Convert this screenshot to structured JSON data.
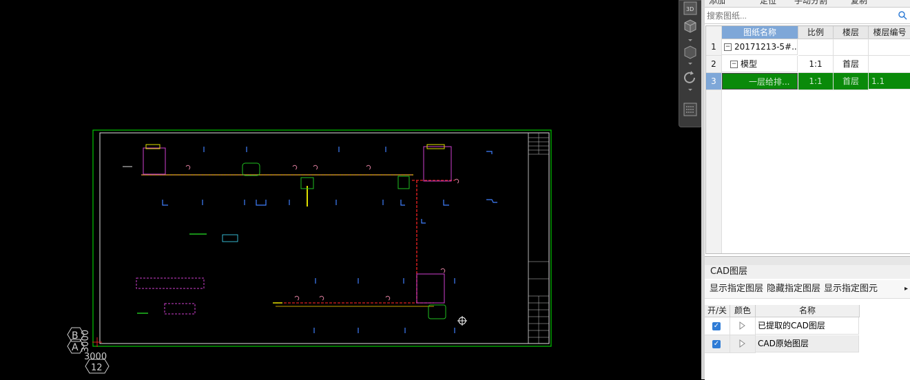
{
  "canvas": {
    "axis_labels": [
      "B",
      "A",
      "3000",
      "3000",
      "12"
    ]
  },
  "view_tools": {
    "button_3d_label": "3D"
  },
  "toolbar": {
    "items": [
      "添加",
      "定位",
      "手动分割",
      "复制"
    ]
  },
  "search": {
    "placeholder": "搜索图纸..."
  },
  "drawing_table": {
    "columns": [
      "图纸名称",
      "比例",
      "楼层",
      "楼层编号"
    ],
    "rows": [
      {
        "num": "1",
        "name": "20171213-5#...",
        "scale": "",
        "floor": "",
        "floor_no": "",
        "toggle": "−"
      },
      {
        "num": "2",
        "name": "模型",
        "scale": "1:1",
        "floor": "首层",
        "floor_no": "",
        "toggle": "−"
      },
      {
        "num": "3",
        "name": "一层给排...",
        "scale": "1:1",
        "floor": "首层",
        "floor_no": "1.1",
        "selected": true
      }
    ]
  },
  "cad_layers": {
    "title": "CAD图层",
    "actions": [
      "显示指定图层",
      "隐藏指定图层",
      "显示指定图元"
    ],
    "columns": [
      "开/关",
      "颜色",
      "名称"
    ],
    "rows": [
      {
        "on": true,
        "name": "已提取的CAD图层"
      },
      {
        "on": true,
        "name": "CAD原始图层"
      }
    ]
  },
  "colors": {
    "selected_row": "#0a8a0a",
    "header_blue": "#7ea7d8",
    "frame_green": "#00c800",
    "checkbox_blue": "#2f7cd6"
  }
}
